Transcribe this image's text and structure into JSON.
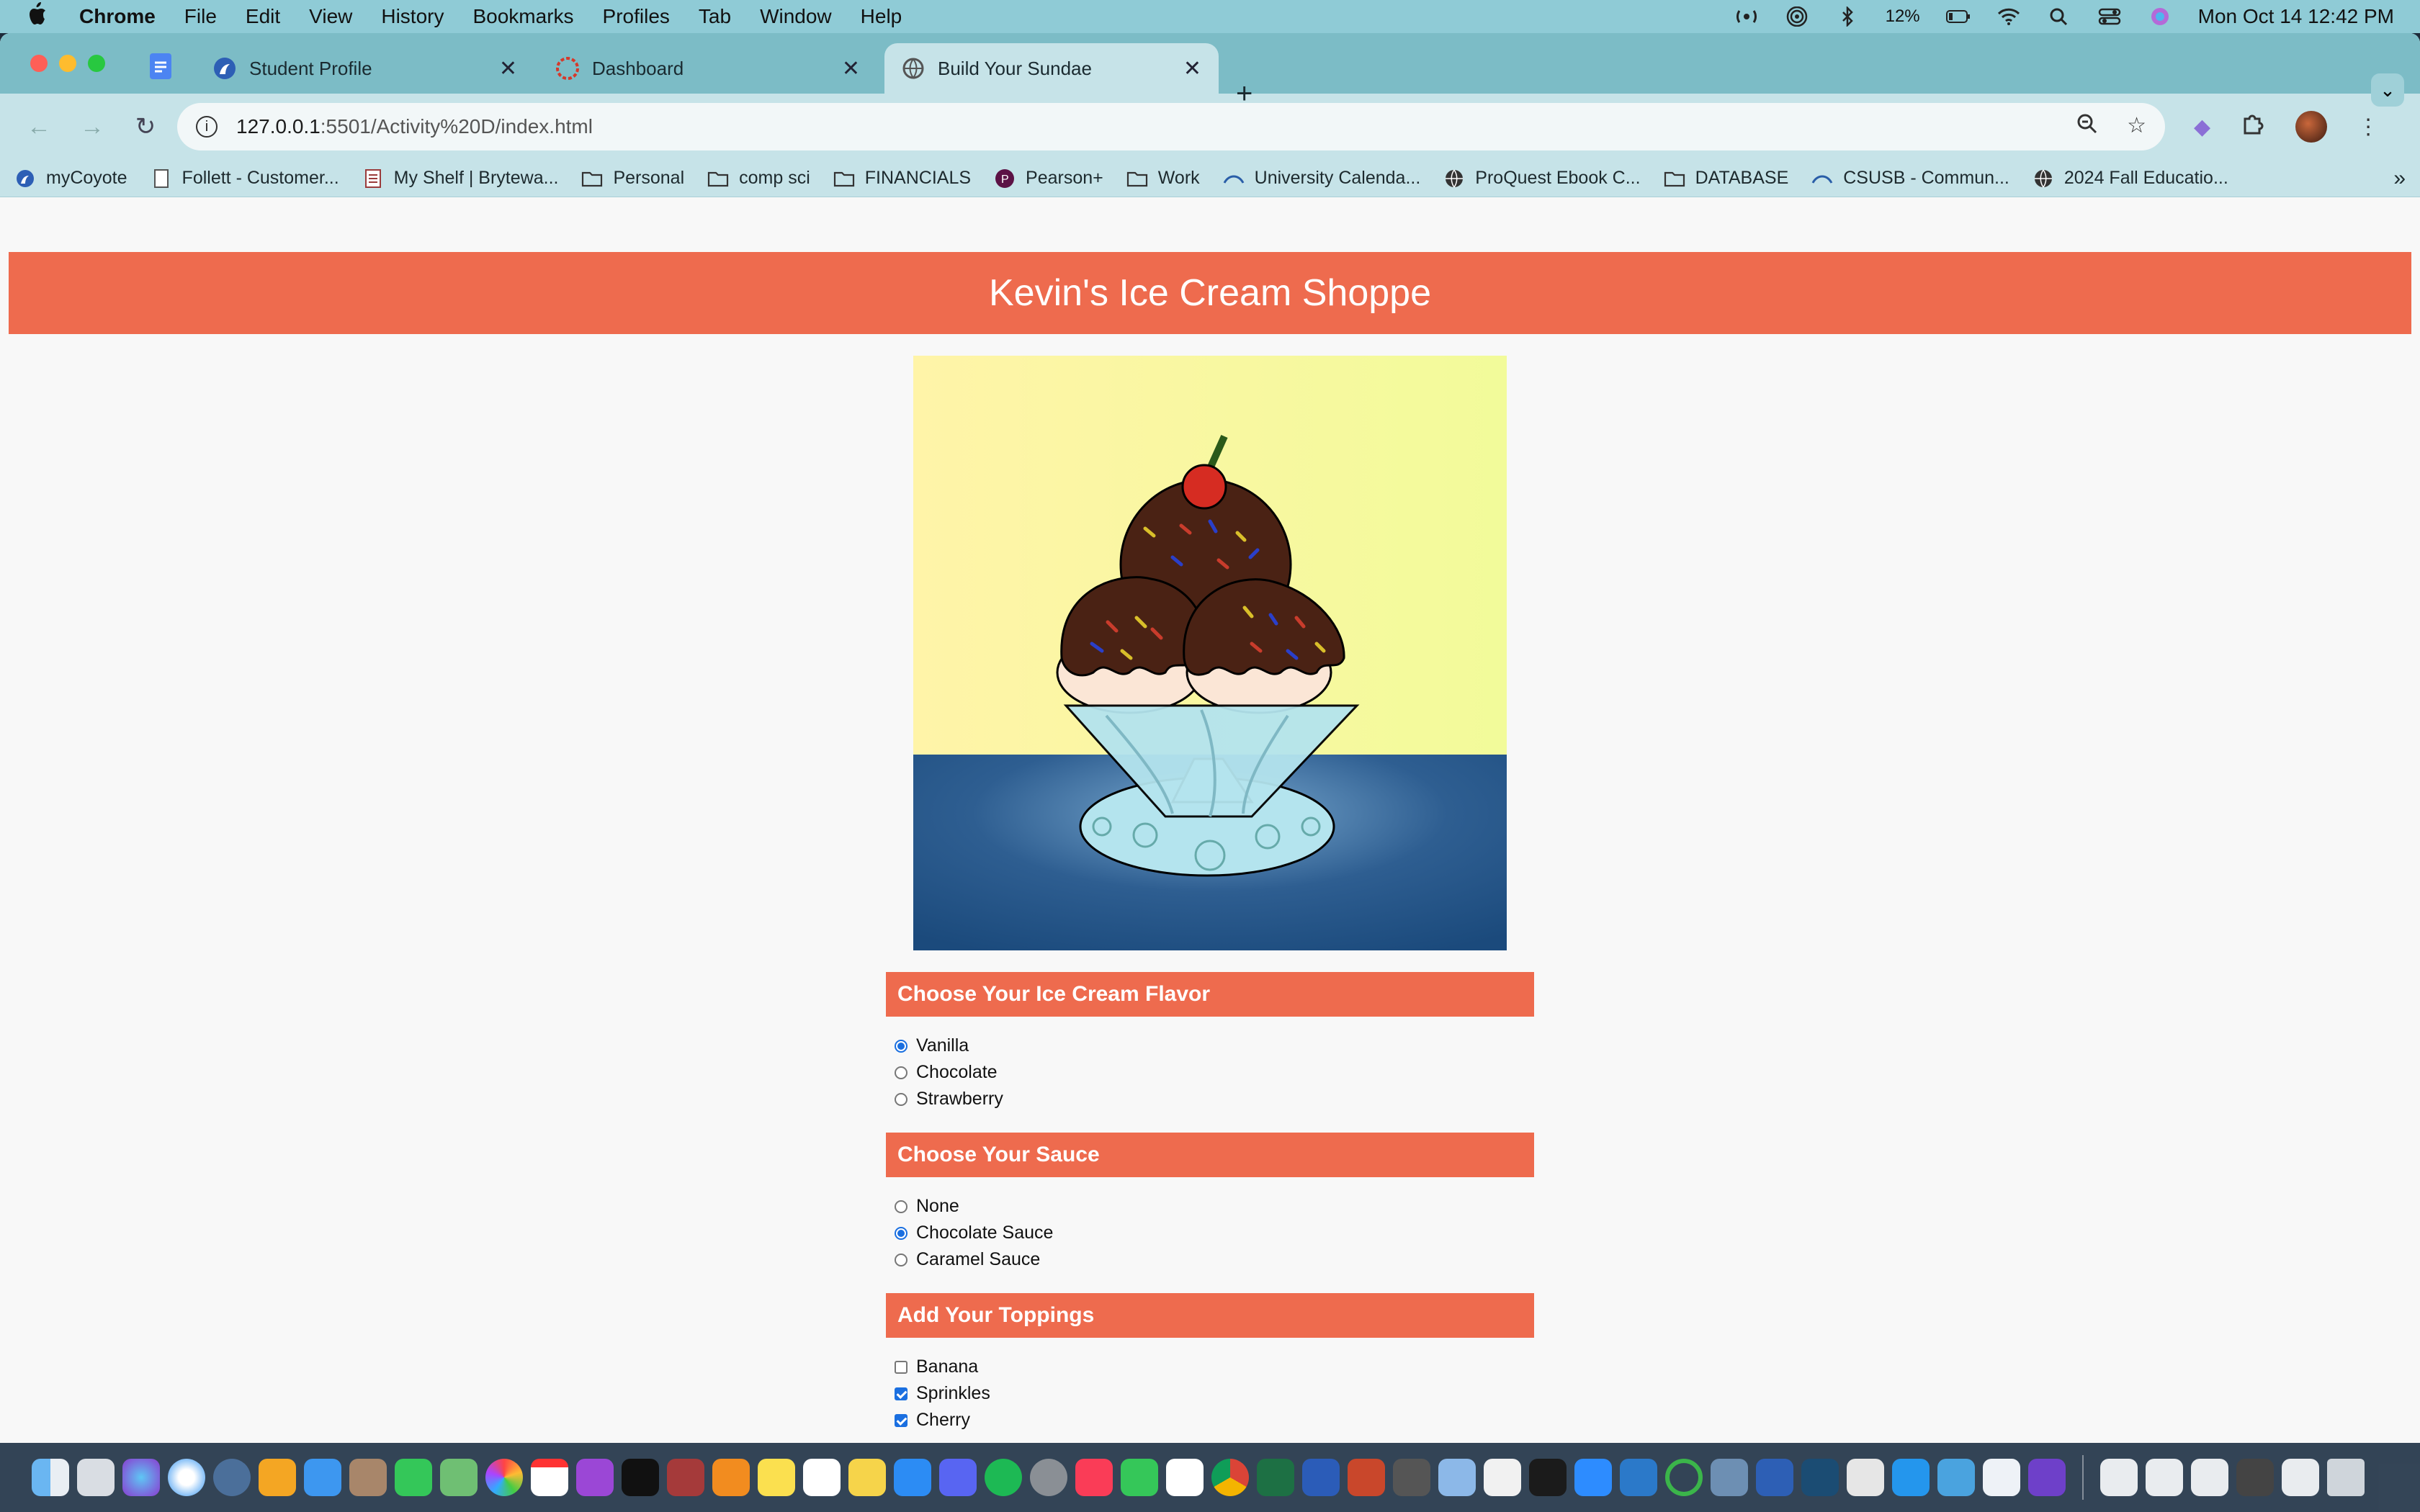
{
  "menubar": {
    "app": "Chrome",
    "items": [
      "File",
      "Edit",
      "View",
      "History",
      "Bookmarks",
      "Profiles",
      "Tab",
      "Window",
      "Help"
    ],
    "battery": "12%",
    "datetime": "Mon Oct 14  12:42 PM"
  },
  "tabs": [
    {
      "title": "Student Profile"
    },
    {
      "title": "Dashboard"
    },
    {
      "title": "Build Your Sundae"
    }
  ],
  "address": {
    "host": "127.0.0.1",
    "path": ":5501/Activity%20D/index.html"
  },
  "bookmarks": [
    {
      "label": "myCoyote",
      "icon": "coyote-icon"
    },
    {
      "label": "Follett - Customer...",
      "icon": "document-icon"
    },
    {
      "label": "My Shelf | Brytewa...",
      "icon": "book-icon"
    },
    {
      "label": "Personal",
      "icon": "folder-icon"
    },
    {
      "label": "comp sci",
      "icon": "folder-icon"
    },
    {
      "label": "FINANCIALS",
      "icon": "folder-icon"
    },
    {
      "label": "Pearson+",
      "icon": "pearson-icon"
    },
    {
      "label": "Work",
      "icon": "folder-icon"
    },
    {
      "label": "University Calenda...",
      "icon": "csusb-icon"
    },
    {
      "label": "ProQuest Ebook C...",
      "icon": "globe-icon"
    },
    {
      "label": "DATABASE",
      "icon": "folder-icon"
    },
    {
      "label": "CSUSB - Commun...",
      "icon": "csusb-icon"
    },
    {
      "label": "2024 Fall Educatio...",
      "icon": "globe-icon"
    }
  ],
  "site": {
    "title": "Kevin's Ice Cream Shoppe"
  },
  "sections": {
    "flavor": {
      "heading": "Choose Your Ice Cream Flavor",
      "options": [
        {
          "label": "Vanilla",
          "checked": true
        },
        {
          "label": "Chocolate",
          "checked": false
        },
        {
          "label": "Strawberry",
          "checked": false
        }
      ]
    },
    "sauce": {
      "heading": "Choose Your Sauce",
      "options": [
        {
          "label": "None",
          "checked": false
        },
        {
          "label": "Chocolate Sauce",
          "checked": true
        },
        {
          "label": "Caramel Sauce",
          "checked": false
        }
      ]
    },
    "toppings": {
      "heading": "Add Your Toppings",
      "options": [
        {
          "label": "Banana",
          "checked": false
        },
        {
          "label": "Sprinkles",
          "checked": true
        },
        {
          "label": "Cherry",
          "checked": true
        }
      ]
    }
  },
  "colors": {
    "brand": "#ee6b4e",
    "accent": "#1a6fe0"
  }
}
